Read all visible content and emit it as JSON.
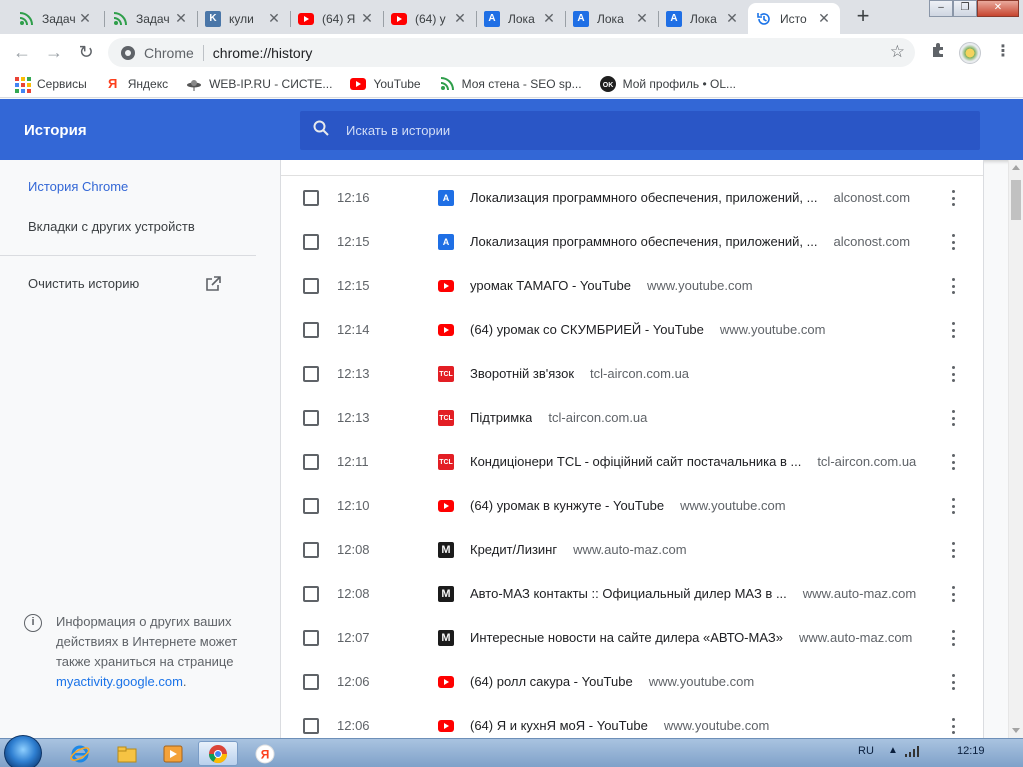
{
  "tabs": [
    {
      "title": "Задач",
      "favicon": "wifi-icon",
      "active": false
    },
    {
      "title": "Задач",
      "favicon": "wifi-icon",
      "active": false
    },
    {
      "title": "кули",
      "favicon": "vk-icon",
      "active": false
    },
    {
      "title": "(64) Я",
      "favicon": "youtube-icon",
      "active": false
    },
    {
      "title": "(64) у",
      "favicon": "youtube-icon",
      "active": false
    },
    {
      "title": "Лока",
      "favicon": "alconost-icon",
      "active": false
    },
    {
      "title": "Лока",
      "favicon": "alconost-icon",
      "active": false
    },
    {
      "title": "Лока",
      "favicon": "alconost-icon",
      "active": false
    },
    {
      "title": "Исто",
      "favicon": "history-icon",
      "active": true
    }
  ],
  "toolbar": {
    "site_chip": "Chrome",
    "url": "chrome://history"
  },
  "bookmarks": [
    {
      "label": "Сервисы",
      "icon": "apps-grid-icon"
    },
    {
      "label": "Яндекс",
      "icon": "yandex-icon"
    },
    {
      "label": "WEB-IP.RU - СИСТЕ...",
      "icon": "ufo-icon"
    },
    {
      "label": "YouTube",
      "icon": "youtube-icon"
    },
    {
      "label": "Моя стена - SEO sp...",
      "icon": "wifi-icon"
    },
    {
      "label": "Мой профиль • OL...",
      "icon": "ok-icon"
    }
  ],
  "header": {
    "title": "История",
    "search_placeholder": "Искать в истории"
  },
  "sidebar": {
    "items": [
      {
        "label": "История Chrome",
        "selected": true
      },
      {
        "label": "Вкладки с других устройств",
        "selected": false
      }
    ],
    "clear_label": "Очистить историю",
    "info_text": "Информация о других ваших действиях в Интернете может также храниться на странице",
    "info_link": "myactivity.google.com",
    "info_link_suffix": "."
  },
  "history": [
    {
      "time": "12:16",
      "title": "Локализация программного обеспечения, приложений, ...",
      "domain": "alconost.com",
      "favicon": "alconost"
    },
    {
      "time": "12:15",
      "title": "Локализация программного обеспечения, приложений, ...",
      "domain": "alconost.com",
      "favicon": "alconost"
    },
    {
      "time": "12:15",
      "title": "уромак ТАМАГО - YouTube",
      "domain": "www.youtube.com",
      "favicon": "youtube"
    },
    {
      "time": "12:14",
      "title": "(64) уромак со СКУМБРИЕЙ - YouTube",
      "domain": "www.youtube.com",
      "favicon": "youtube"
    },
    {
      "time": "12:13",
      "title": "Зворотній зв'язок",
      "domain": "tcl-aircon.com.ua",
      "favicon": "tcl"
    },
    {
      "time": "12:13",
      "title": "Підтримка",
      "domain": "tcl-aircon.com.ua",
      "favicon": "tcl"
    },
    {
      "time": "12:11",
      "title": "Кондиціонери TCL - офіційний сайт постачальника в ...",
      "domain": "tcl-aircon.com.ua",
      "favicon": "tcl"
    },
    {
      "time": "12:10",
      "title": "(64) уромак в кунжуте - YouTube",
      "domain": "www.youtube.com",
      "favicon": "youtube"
    },
    {
      "time": "12:08",
      "title": "Кредит/Лизинг",
      "domain": "www.auto-maz.com",
      "favicon": "maz"
    },
    {
      "time": "12:08",
      "title": "Авто-МАЗ контакты :: Официальный дилер МАЗ в ...",
      "domain": "www.auto-maz.com",
      "favicon": "maz"
    },
    {
      "time": "12:07",
      "title": "Интересные новости на сайте дилера «АВТО-МАЗ»",
      "domain": "www.auto-maz.com",
      "favicon": "maz"
    },
    {
      "time": "12:06",
      "title": "(64) ролл сакура - YouTube",
      "domain": "www.youtube.com",
      "favicon": "youtube"
    },
    {
      "time": "12:06",
      "title": "(64) Я и кухнЯ моЯ - YouTube",
      "domain": "www.youtube.com",
      "favicon": "youtube"
    }
  ],
  "taskbar": {
    "language": "RU",
    "clock": "12:19"
  },
  "colors": {
    "header_blue": "#3367d6",
    "search_blue": "#2a56c6",
    "youtube_red": "#ff0000",
    "tcl_red": "#e31e24"
  }
}
